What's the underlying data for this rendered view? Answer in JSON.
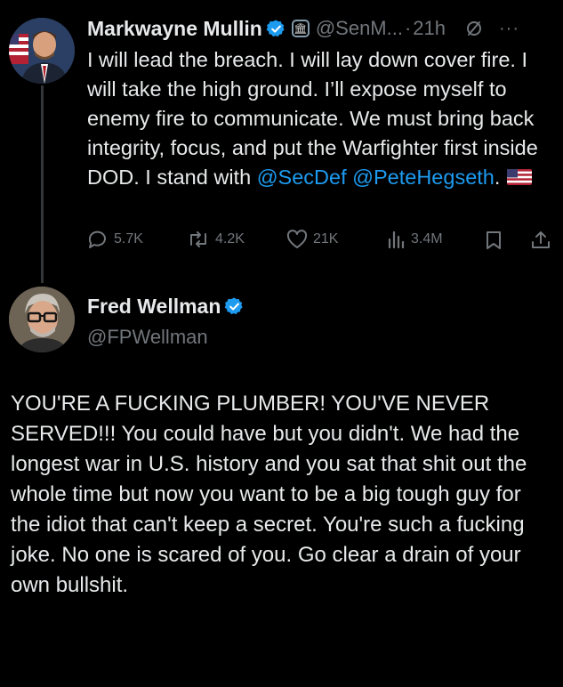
{
  "tweet": {
    "author_name": "Markwayne Mullin",
    "handle": "@SenM...",
    "dot": "·",
    "time": "21h",
    "body_text": "I will lead the breach. I will lay down cover fire. I will take the high ground. I’ll expose myself to enemy fire to communicate. We must bring back integrity, focus, and put the Warfighter first inside DOD. I stand with",
    "mention_1": "@SecDef",
    "mention_2": "@PeteHegseth",
    "after_mention": ".",
    "more": "···",
    "stats": {
      "replies": "5.7K",
      "reposts": "4.2K",
      "likes": "21K",
      "views": "3.4M"
    }
  },
  "reply": {
    "author_name": "Fred Wellman",
    "handle": "@FPWellman",
    "body_text": "YOU'RE A FUCKING PLUMBER! YOU'VE NEVER SERVED!!! You could have but you didn't.  We had the longest war in U.S. history and you sat that shit out the whole time but now you want to be a big tough guy for the idiot that can't keep a secret. You're such a fucking joke. No one is scared of you. Go clear a drain of your own bullshit."
  },
  "colors": {
    "background": "#000000",
    "text": "#e7e9ea",
    "muted": "#71767b",
    "link": "#1d9bf0",
    "verified": "#1d9bf0"
  }
}
